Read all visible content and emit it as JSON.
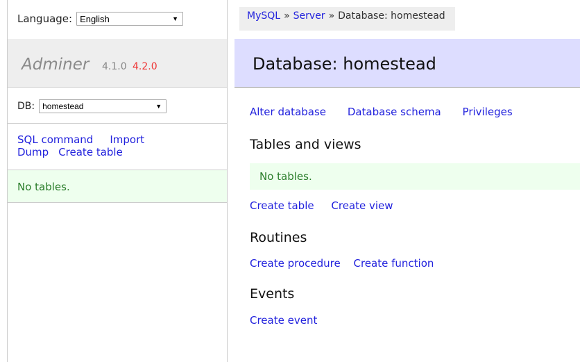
{
  "sidebar": {
    "language_label": "Language:",
    "language_value": "English",
    "brand": "Adminer",
    "version_current": "4.1.0",
    "version_new": "4.2.0",
    "db_label": "DB:",
    "db_value": "homestead",
    "links": {
      "sql_command": "SQL command",
      "import": "Import",
      "dump": "Dump",
      "create_table": "Create table"
    },
    "message": "No tables."
  },
  "breadcrumb": {
    "mysql": "MySQL",
    "sep1": "»",
    "server": "Server",
    "sep2": "»",
    "current": "Database: homestead"
  },
  "main": {
    "title": "Database: homestead",
    "links": {
      "alter_database": "Alter database",
      "database_schema": "Database schema",
      "privileges": "Privileges"
    },
    "tables": {
      "heading": "Tables and views",
      "message": "No tables.",
      "create_table": "Create table",
      "create_view": "Create view"
    },
    "routines": {
      "heading": "Routines",
      "create_procedure": "Create procedure",
      "create_function": "Create function"
    },
    "events": {
      "heading": "Events",
      "create_event": "Create event"
    }
  },
  "colors": {
    "link": "#2222dd",
    "title_band": "#ddddff",
    "message_bg": "#eeffee",
    "message_text": "#2a7d2a",
    "version_new": "#ee3333"
  }
}
